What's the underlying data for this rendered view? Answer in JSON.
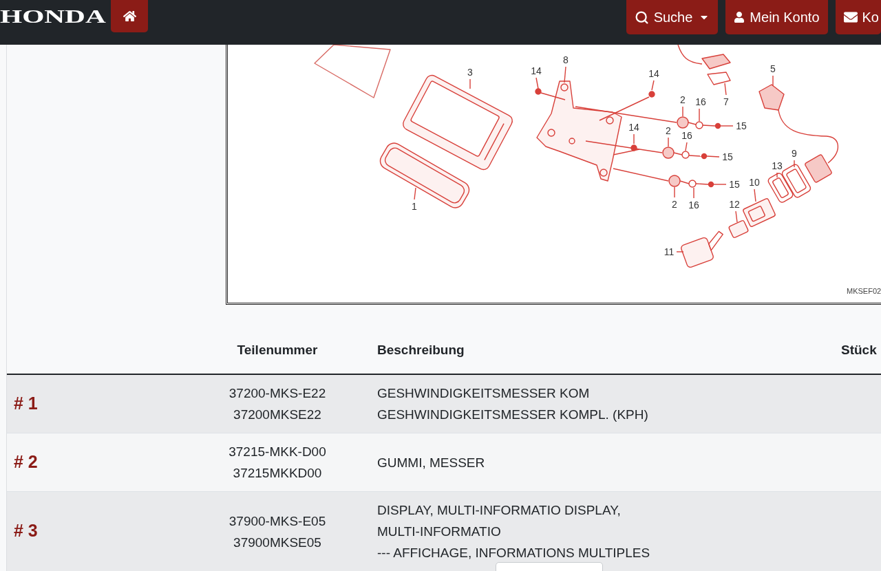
{
  "header": {
    "logo": "HONDA",
    "buttons": [
      {
        "kind": "home",
        "dropdown": false
      },
      {
        "kind": "search",
        "label": "Suche",
        "dropdown": true
      },
      {
        "kind": "account",
        "label": "Mein Konto",
        "dropdown": false
      },
      {
        "kind": "contact",
        "label": "Ko",
        "dropdown": false
      }
    ]
  },
  "diagram": {
    "callouts": [
      "3",
      "14",
      "8",
      "14",
      "5",
      "2",
      "16",
      "7",
      "14",
      "2",
      "16",
      "15",
      "15",
      "13",
      "9",
      "15",
      "10",
      "1",
      "2",
      "16",
      "12",
      "11"
    ],
    "code": "MKSEF02"
  },
  "table": {
    "columns": [
      "Teilenummer",
      "Beschreibung",
      "Stück"
    ],
    "rows": [
      {
        "label": "# 1",
        "part_numbers": [
          "37200-MKS-E22",
          "37200MKSE22"
        ],
        "description": [
          "GESHWINDIGKEITSMESSER KOM",
          "GESHWINDIGKEITSMESSER KOMPL. (KPH)"
        ]
      },
      {
        "label": "# 2",
        "part_numbers": [
          "37215-MKK-D00",
          "37215MKKD00"
        ],
        "description": [
          "GUMMI, MESSER"
        ]
      },
      {
        "label": "# 3",
        "part_numbers": [
          "37900-MKS-E05",
          "37900MKSE05"
        ],
        "description": [
          "DISPLAY, MULTI-INFORMATIO DISPLAY,",
          "MULTI-INFORMATIO",
          "--- AFFICHAGE, INFORMATIONS MULTIPLES"
        ]
      }
    ]
  }
}
